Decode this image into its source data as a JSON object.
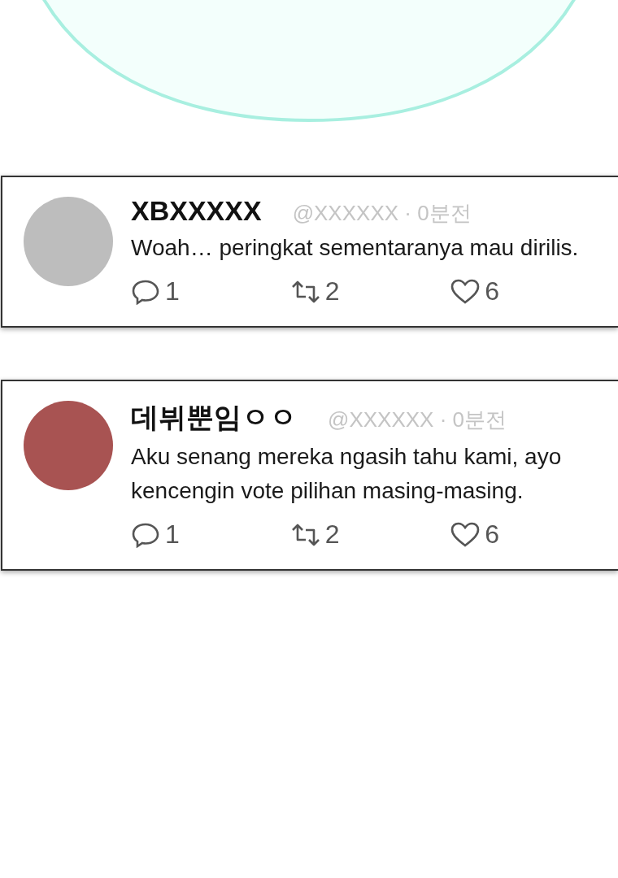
{
  "posts": [
    {
      "name": "XBXXXXX",
      "handle": "@XXXXXX · 0분전",
      "color": "#bdbdbd",
      "text": "Woah… peringkat sementaranya mau dirilis.",
      "replies": "1",
      "reposts": "2",
      "likes": "6"
    },
    {
      "name": "데뷔뿐임ㅇㅇ",
      "handle": "@XXXXXX · 0분전",
      "color": "#a85352",
      "text": "Aku senang mereka ngasih tahu kami, ayo kencengin vote pilihan masing-masing.",
      "replies": "1",
      "reposts": "2",
      "likes": "6"
    }
  ]
}
